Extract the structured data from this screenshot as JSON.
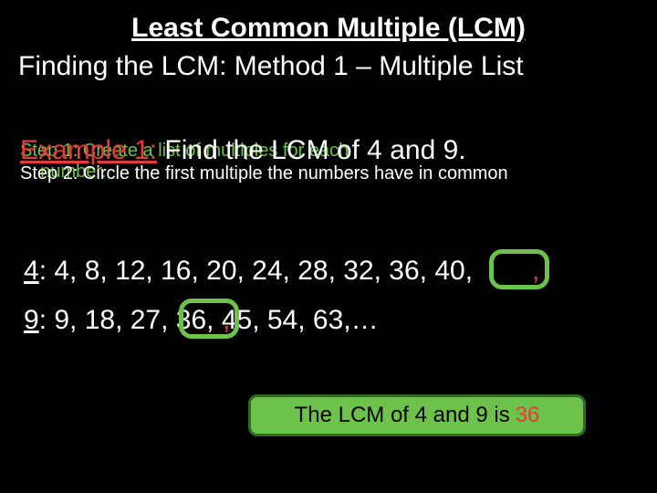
{
  "title": "Least Common Multiple (LCM)",
  "subtitle": "Finding the LCM: Method 1 – Multiple List",
  "step1": "Step 1: Create a list of multiples for each",
  "example_label": "Example 1:",
  "example_body": " Find the LCM of 4 and 9.",
  "step2_green_prefix": "    number.",
  "step2_white": "Step 2: Circle the first multiple the numbers have in common",
  "multiples4_lead": "4",
  "multiples4_rest": ": 4, 8, 12, 16, 20, 24, 28, 32, 36, 40,",
  "multiples9_lead": "9",
  "multiples9_rest": ": 9, 18, 27, 36, 45, 54, 63,…",
  "comma": ",",
  "answer_text": "The LCM of 4 and 9 is",
  "answer_value": "36"
}
